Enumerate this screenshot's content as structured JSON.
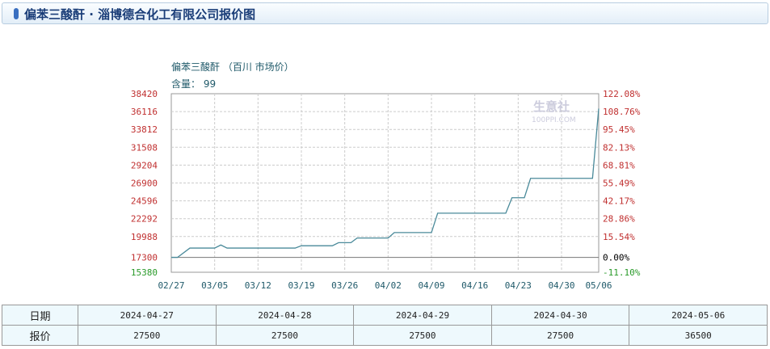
{
  "header": {
    "title": "偏苯三酸酐 · 淄博德合化工有限公司报价图"
  },
  "chart_data": {
    "type": "line",
    "title": "偏苯三酸酐 （百川  市场价）",
    "subtitle": "含量： 99",
    "watermark": "生意社 100PPI.COM",
    "x_ticks": [
      "02/27",
      "03/05",
      "03/12",
      "03/19",
      "03/26",
      "04/02",
      "04/09",
      "04/16",
      "04/23",
      "04/30",
      "05/06"
    ],
    "y_ticks": [
      38420,
      36116,
      33812,
      31508,
      29204,
      26900,
      24596,
      22292,
      19988,
      17300,
      15380
    ],
    "y_ticks_right": [
      "122.08%",
      "108.76%",
      "95.45%",
      "82.13%",
      "68.81%",
      "55.49%",
      "42.17%",
      "28.86%",
      "15.54%",
      "0.00%",
      "-11.10%"
    ],
    "ylim": [
      15380,
      38420
    ],
    "xlim": [
      "02/27",
      "05/06"
    ],
    "baseline": 17300,
    "grid": true,
    "line_color": "#4a8a9a",
    "points": [
      [
        "02/27",
        17300
      ],
      [
        "02/28",
        17300
      ],
      [
        "03/01",
        18500
      ],
      [
        "03/05",
        18500
      ],
      [
        "03/06",
        18900
      ],
      [
        "03/07",
        18500
      ],
      [
        "03/18",
        18500
      ],
      [
        "03/19",
        18800
      ],
      [
        "03/24",
        18800
      ],
      [
        "03/25",
        19200
      ],
      [
        "03/27",
        19200
      ],
      [
        "03/28",
        19800
      ],
      [
        "04/02",
        19800
      ],
      [
        "04/03",
        20500
      ],
      [
        "04/09",
        20500
      ],
      [
        "04/10",
        23000
      ],
      [
        "04/21",
        23000
      ],
      [
        "04/22",
        25000
      ],
      [
        "04/24",
        25000
      ],
      [
        "04/25",
        27500
      ],
      [
        "05/05",
        27500
      ],
      [
        "05/06",
        36500
      ]
    ]
  },
  "table": {
    "row_labels": [
      "日期",
      "报价"
    ],
    "dates": [
      "2024-04-27",
      "2024-04-28",
      "2024-04-29",
      "2024-04-30",
      "2024-05-06"
    ],
    "prices": [
      "27500",
      "27500",
      "27500",
      "27500",
      "36500"
    ]
  }
}
